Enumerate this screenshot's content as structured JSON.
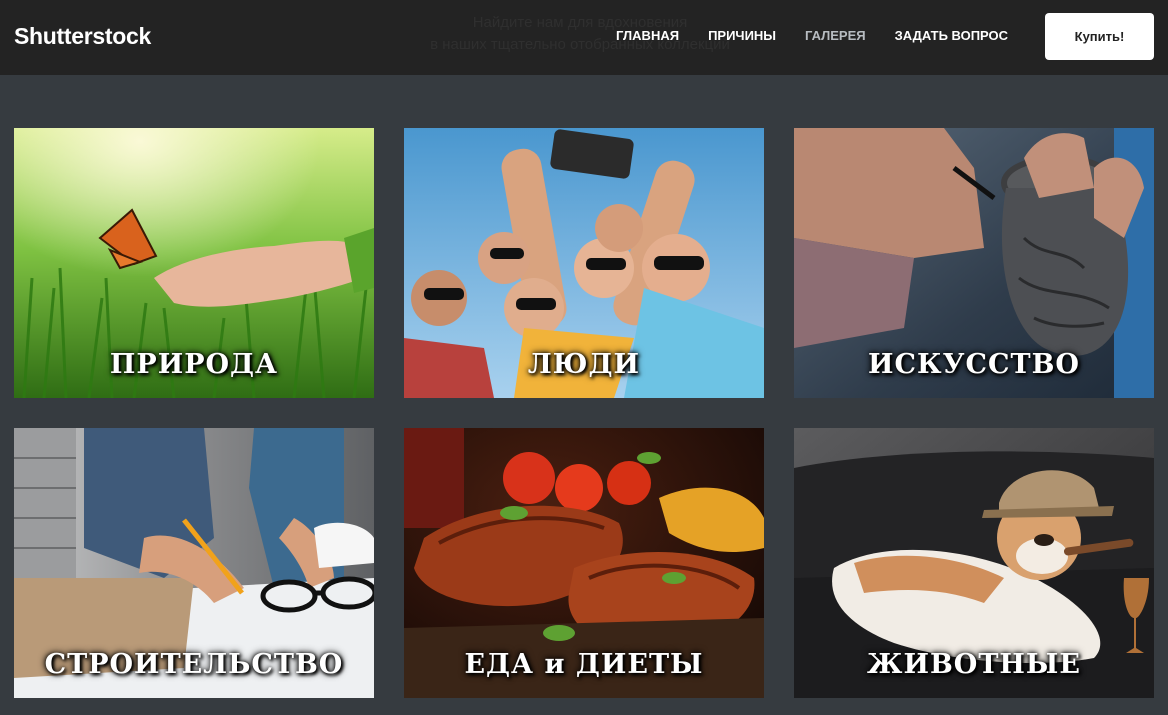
{
  "header": {
    "logo": "Shutterstock",
    "ghost_line1": "Найдите нам для вдохновения",
    "ghost_line2": "в наших тщательно отобранных коллекций",
    "nav": [
      {
        "label": "ГЛАВНАЯ",
        "active": false
      },
      {
        "label": "ПРИЧИНЫ",
        "active": false
      },
      {
        "label": "ГАЛЕРЕЯ",
        "active": true
      },
      {
        "label": "ЗАДАТЬ ВОПРОС",
        "active": false
      }
    ],
    "buy_label": "Купить!"
  },
  "gallery": {
    "tiles": [
      {
        "caption": "ПРИРОДА",
        "image": "butterfly-on-hand-grass"
      },
      {
        "caption": "ЛЮДИ",
        "image": "friends-selfie"
      },
      {
        "caption": "ИСКУССТВО",
        "image": "pottery-carving"
      },
      {
        "caption": "СТРОИТЕЛЬСТВО",
        "image": "architects-blueprints"
      },
      {
        "caption": "ЕДА и ДИЕТЫ",
        "image": "grilled-steaks"
      },
      {
        "caption": "ЖИВОТНЫЕ",
        "image": "bulldog-with-hat-cigar"
      }
    ]
  },
  "colors": {
    "header_bg": "#232323",
    "page_bg": "#363b40",
    "nav_active": "#b7bcc1",
    "button_bg": "#ffffff"
  }
}
